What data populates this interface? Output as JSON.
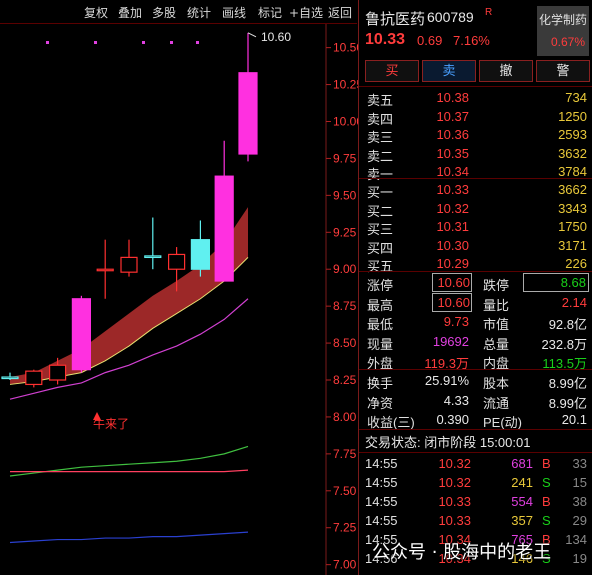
{
  "toolbar": {
    "buttons": [
      "复权",
      "叠加",
      "多股",
      "统计",
      "画线",
      "标记",
      "+自选",
      "返回"
    ]
  },
  "stock": {
    "name": "鲁抗医药",
    "code": "600789",
    "flag": "R",
    "industry": "化学制药",
    "industry_change": "0.67%",
    "price": "10.33",
    "change": "0.69",
    "change_pct": "7.16%"
  },
  "trade_buttons": [
    "买",
    "卖",
    "撤",
    "警"
  ],
  "order_book": {
    "asks": [
      {
        "label": "卖五",
        "price": "10.38",
        "vol": "734"
      },
      {
        "label": "卖四",
        "price": "10.37",
        "vol": "1250"
      },
      {
        "label": "卖三",
        "price": "10.36",
        "vol": "2593"
      },
      {
        "label": "卖二",
        "price": "10.35",
        "vol": "3632"
      },
      {
        "label": "卖一",
        "price": "10.34",
        "vol": "3784"
      }
    ],
    "bids": [
      {
        "label": "买一",
        "price": "10.33",
        "vol": "3662"
      },
      {
        "label": "买二",
        "price": "10.32",
        "vol": "3343"
      },
      {
        "label": "买三",
        "price": "10.31",
        "vol": "1750"
      },
      {
        "label": "买四",
        "price": "10.30",
        "vol": "3171"
      },
      {
        "label": "买五",
        "price": "10.29",
        "vol": "226"
      }
    ]
  },
  "stats": [
    {
      "l1": "涨停",
      "v1": "10.60",
      "l2": "跌停",
      "v2": "8.68"
    },
    {
      "l1": "最高",
      "v1": "10.60",
      "l2": "量比",
      "v2": "2.14"
    },
    {
      "l1": "最低",
      "v1": "9.73",
      "l2": "市值",
      "v2": "92.8亿"
    },
    {
      "l1": "现量",
      "v1": "19692",
      "l2": "总量",
      "v2": "232.8万"
    },
    {
      "l1": "外盘",
      "v1": "119.3万",
      "l2": "内盘",
      "v2": "113.5万"
    }
  ],
  "stats2": [
    {
      "l1": "换手",
      "v1": "25.91%",
      "l2": "股本",
      "v2": "8.99亿"
    },
    {
      "l1": "净资",
      "v1": "4.33",
      "l2": "流通",
      "v2": "8.99亿"
    },
    {
      "l1": "收益(三)",
      "v1": "0.390",
      "l2": "PE(动)",
      "v2": "20.1"
    }
  ],
  "trade_status": "交易状态: 闭市阶段 15:00:01",
  "ticks": [
    {
      "time": "14:55",
      "price": "10.32",
      "vol": "681",
      "side": "B",
      "n": "33"
    },
    {
      "time": "14:55",
      "price": "10.32",
      "vol": "241",
      "side": "S",
      "n": "15"
    },
    {
      "time": "14:55",
      "price": "10.33",
      "vol": "554",
      "side": "B",
      "n": "38"
    },
    {
      "time": "14:55",
      "price": "10.33",
      "vol": "357",
      "side": "S",
      "n": "29"
    },
    {
      "time": "14:55",
      "price": "10.34",
      "vol": "765",
      "side": "B",
      "n": "134"
    },
    {
      "time": "14:56",
      "price": "10.34",
      "vol": "146",
      "side": "S",
      "n": "19"
    }
  ],
  "chart": {
    "high_label": "10.60",
    "annotation": "牛来了",
    "watermark": "公众号 · 股海中的老王",
    "y_ticks": [
      "10.50",
      "10.25",
      "10.00",
      "9.75",
      "9.50",
      "9.25",
      "9.00",
      "8.75",
      "8.50",
      "8.25",
      "8.00",
      "7.75",
      "7.50",
      "7.25",
      "7.00"
    ]
  },
  "chart_data": {
    "type": "candlestick",
    "ylim": [
      6.93,
      10.66
    ],
    "candles": [
      {
        "o": 8.27,
        "c": 8.27,
        "h": 8.3,
        "l": 8.25,
        "color": "cyan"
      },
      {
        "o": 8.31,
        "c": 8.22,
        "h": 8.32,
        "l": 8.2,
        "color": "red"
      },
      {
        "o": 8.25,
        "c": 8.35,
        "h": 8.4,
        "l": 8.22,
        "color": "red"
      },
      {
        "o": 8.32,
        "c": 8.8,
        "h": 8.82,
        "l": 8.3,
        "color": "magenta"
      },
      {
        "o": 9.0,
        "c": 9.0,
        "h": 9.2,
        "l": 8.8,
        "color": "red"
      },
      {
        "o": 8.98,
        "c": 9.08,
        "h": 9.2,
        "l": 8.95,
        "color": "red"
      },
      {
        "o": 9.09,
        "c": 9.09,
        "h": 9.35,
        "l": 9.0,
        "color": "cyan"
      },
      {
        "o": 9.1,
        "c": 9.0,
        "h": 9.15,
        "l": 8.85,
        "color": "red"
      },
      {
        "o": 9.0,
        "c": 9.2,
        "h": 9.33,
        "l": 8.95,
        "color": "cyan"
      },
      {
        "o": 8.92,
        "c": 9.63,
        "h": 9.87,
        "l": 8.92,
        "color": "magenta"
      },
      {
        "o": 9.78,
        "c": 10.33,
        "h": 10.6,
        "l": 9.73,
        "color": "magenta"
      }
    ],
    "ribbon_upper": [
      8.27,
      8.3,
      8.38,
      8.46,
      8.58,
      8.7,
      8.82,
      8.92,
      9.03,
      9.18,
      9.42
    ],
    "ribbon_lower": [
      8.22,
      8.24,
      8.27,
      8.3,
      8.38,
      8.48,
      8.6,
      8.7,
      8.8,
      8.92,
      9.08
    ],
    "ma_magenta": [
      8.12,
      8.16,
      8.2,
      8.23,
      8.3,
      8.35,
      8.42,
      8.48,
      8.56,
      8.66,
      8.8
    ],
    "ma_green": [
      7.6,
      7.62,
      7.64,
      7.66,
      7.67,
      7.68,
      7.69,
      7.7,
      7.72,
      7.75,
      7.8
    ],
    "ma_pink": [
      7.63,
      7.63,
      7.63,
      7.63,
      7.63,
      7.63,
      7.63,
      7.63,
      7.63,
      7.63,
      7.64
    ],
    "ma_blue": [
      7.15,
      7.16,
      7.17,
      7.17,
      7.18,
      7.18,
      7.19,
      7.19,
      7.2,
      7.21,
      7.22
    ]
  }
}
